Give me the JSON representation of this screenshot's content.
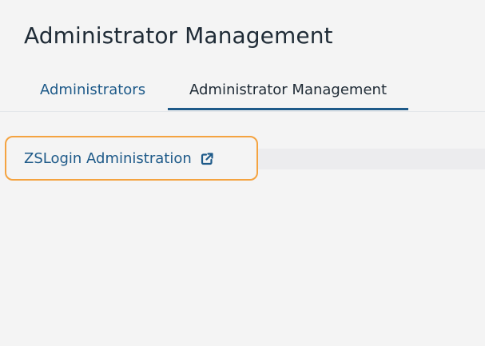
{
  "page": {
    "title": "Administrator Management"
  },
  "tabs": [
    {
      "label": "Administrators",
      "active": false
    },
    {
      "label": "Administrator Management",
      "active": true
    }
  ],
  "content": {
    "link_label": "ZSLogin Administration",
    "link_icon": "external-link-icon"
  },
  "colors": {
    "accent": "#1e5a89",
    "highlight": "#f4a340",
    "background": "#f4f4f4"
  }
}
